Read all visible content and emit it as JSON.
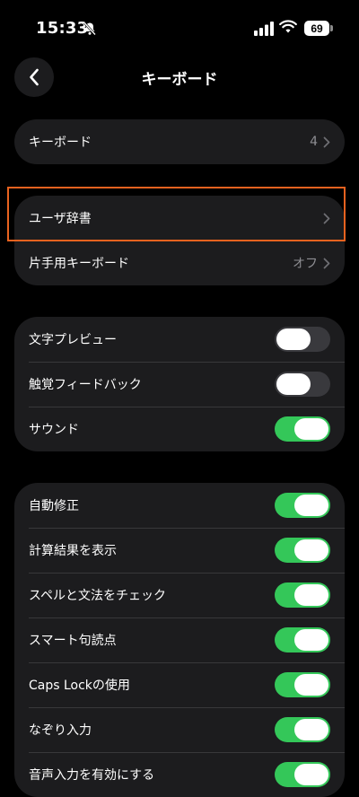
{
  "status": {
    "time": "15:33",
    "battery": "69"
  },
  "nav": {
    "title": "キーボード"
  },
  "keyboards": {
    "label": "キーボード",
    "value": "4"
  },
  "dictionary": {
    "user_dictionary_label": "ユーザ辞書",
    "one_handed_label": "片手用キーボード",
    "one_handed_value": "オフ"
  },
  "feedback": {
    "items": [
      {
        "label": "文字プレビュー",
        "on": false
      },
      {
        "label": "触覚フィードバック",
        "on": false
      },
      {
        "label": "サウンド",
        "on": true
      }
    ]
  },
  "typing": {
    "items": [
      {
        "label": "自動修正",
        "on": true
      },
      {
        "label": "計算結果を表示",
        "on": true
      },
      {
        "label": "スペルと文法をチェック",
        "on": true
      },
      {
        "label": "スマート句読点",
        "on": true
      },
      {
        "label": "Caps Lockの使用",
        "on": true
      },
      {
        "label": "なぞり入力",
        "on": true
      },
      {
        "label": "音声入力を有効にする",
        "on": true
      }
    ]
  },
  "colors": {
    "toggle_on": "#34c759",
    "toggle_off": "#39393d",
    "highlight": "#e8621f"
  }
}
